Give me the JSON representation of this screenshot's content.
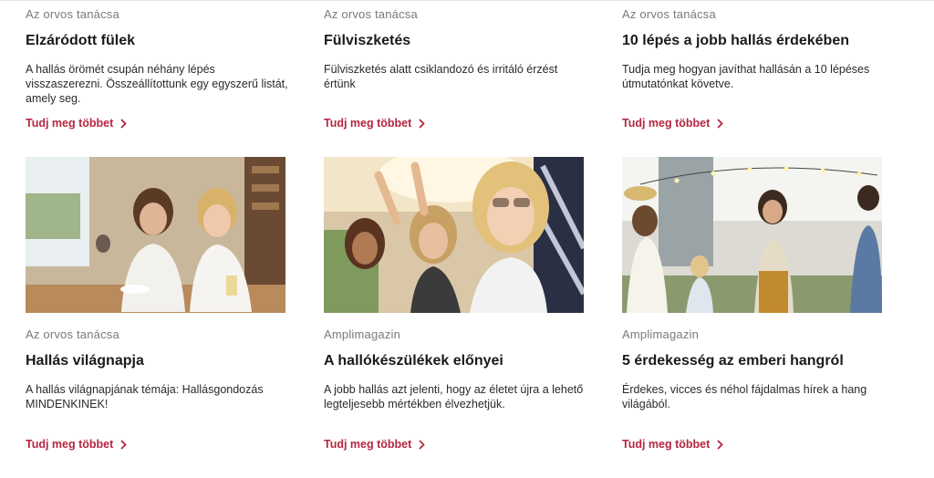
{
  "more_label": "Tudj meg többet",
  "cards_top": [
    {
      "category": "Az orvos tanácsa",
      "title": "Elzáródott fülek",
      "desc": "A hallás örömét csupán néhány lépés visszaszerezni. Összeállítottunk egy egyszerű listát, amely seg."
    },
    {
      "category": "Az orvos tanácsa",
      "title": "Fülviszketés",
      "desc": "Fülviszketés alatt csiklandozó és irritáló érzést értünk"
    },
    {
      "category": "Az orvos tanácsa",
      "title": "10 lépés a jobb hallás érdekében",
      "desc": "Tudja meg hogyan javíthat hallásán a 10 lépéses útmutatónkat követve."
    }
  ],
  "cards_bottom": [
    {
      "category": "Az orvos tanácsa",
      "title": "Hallás világnapja",
      "desc": "A hallás világnapjának témája: Hallásgondozás MINDENKINEK!"
    },
    {
      "category": "Amplimagazin",
      "title": "A hallókészülékek előnyei",
      "desc": "A jobb hallás azt jelenti, hogy az életet újra a lehető legteljesebb mértékben élvezhetjük."
    },
    {
      "category": "Amplimagazin",
      "title": "5 érdekesség az emberi hangról",
      "desc": "Érdekes, vicces és néhol fájdalmas hírek a hang világából."
    }
  ],
  "colors": {
    "accent": "#b5263f",
    "category": "#7a7a7a"
  }
}
